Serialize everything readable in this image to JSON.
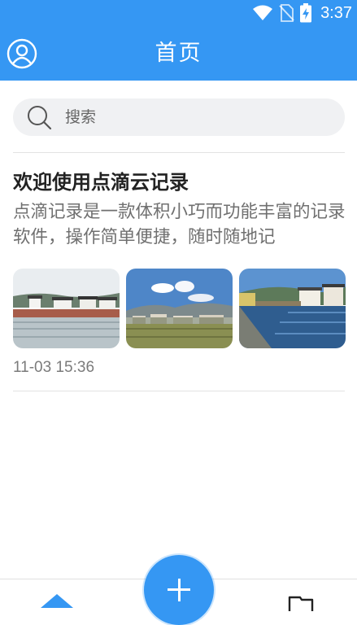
{
  "status_bar": {
    "time": "3:37",
    "icons": [
      "wifi-icon",
      "no-sim-icon",
      "battery-charging-icon"
    ]
  },
  "app_bar": {
    "title": "首页",
    "left_icon": "user-avatar-icon"
  },
  "search": {
    "placeholder": "搜索",
    "value": ""
  },
  "notes": [
    {
      "title": "欢迎使用点滴云记录",
      "body": "点滴记录是一款体积小巧而功能丰富的记录软件，操作简单便捷，随时随地记",
      "images": [
        "village-lake-photo",
        "village-mountain-photo",
        "village-pond-photo"
      ],
      "time": "11-03 15:36"
    }
  ],
  "bottom_nav": {
    "items": [
      "home-icon",
      "flag-icon"
    ],
    "fab": "add-icon"
  },
  "colors": {
    "primary": "#3597f3",
    "search_bg": "#f0f1f3",
    "title_text": "#222222",
    "body_text": "#707070",
    "time_text": "#7b7b7b"
  }
}
